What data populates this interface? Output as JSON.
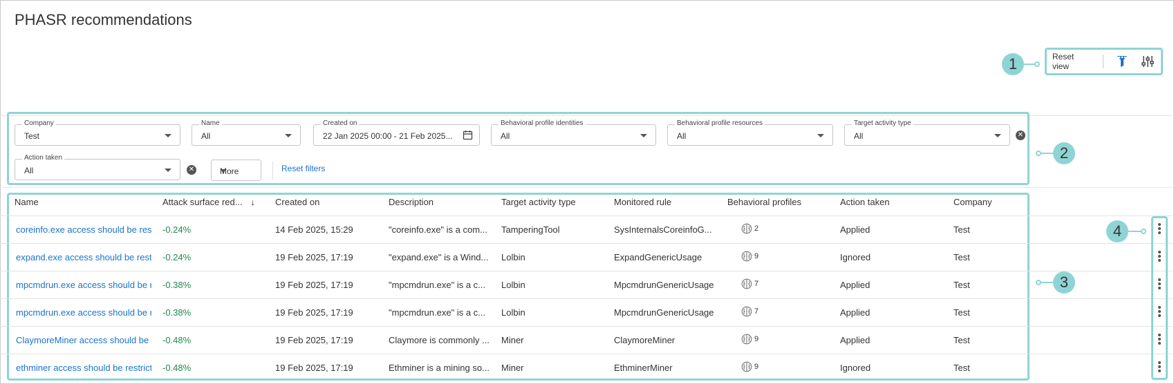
{
  "page": {
    "title": "PHASR recommendations"
  },
  "toolbar": {
    "reset_view": "Reset view",
    "icons": [
      "filter-icon",
      "column-settings-icon"
    ]
  },
  "filters": {
    "company": {
      "label": "Company",
      "value": "Test"
    },
    "name": {
      "label": "Name",
      "value": "All"
    },
    "created_on": {
      "label": "Created on",
      "value": "22 Jan 2025 00:00 - 21 Feb 2025..."
    },
    "bp_identities": {
      "label": "Behavioral profile identities",
      "value": "All"
    },
    "bp_resources": {
      "label": "Behavioral profile resources",
      "value": "All"
    },
    "target_activity": {
      "label": "Target activity type",
      "value": "All"
    },
    "action_taken": {
      "label": "Action taken",
      "value": "All"
    },
    "more": "More",
    "reset": "Reset filters"
  },
  "table": {
    "columns": [
      "Name",
      "Attack surface red...",
      "Created on",
      "Description",
      "Target activity type",
      "Monitored rule",
      "Behavioral profiles",
      "Action taken",
      "Company"
    ],
    "sort_indicator": "↓",
    "rows": [
      {
        "name": "coreinfo.exe access should be restricted",
        "attack": "-0.24%",
        "created": "14 Feb 2025, 15:29",
        "description": "\"coreinfo.exe\" is a com...",
        "target": "TamperingTool",
        "rule": "SysInternalsCoreinfoG...",
        "profiles": "2",
        "action": "Applied",
        "company": "Test"
      },
      {
        "name": "expand.exe access should be restricted",
        "attack": "-0.24%",
        "created": "19 Feb 2025, 17:19",
        "description": "\"expand.exe\" is a Wind...",
        "target": "Lolbin",
        "rule": "ExpandGenericUsage",
        "profiles": "9",
        "action": "Ignored",
        "company": "Test"
      },
      {
        "name": "mpcmdrun.exe access should be restricted",
        "attack": "-0.38%",
        "created": "19 Feb 2025, 17:19",
        "description": "\"mpcmdrun.exe\" is a c...",
        "target": "Lolbin",
        "rule": "MpcmdrunGenericUsage",
        "profiles": "7",
        "action": "Applied",
        "company": "Test"
      },
      {
        "name": "mpcmdrun.exe access should be restricted",
        "attack": "-0.38%",
        "created": "19 Feb 2025, 17:19",
        "description": "\"mpcmdrun.exe\" is a c...",
        "target": "Lolbin",
        "rule": "MpcmdrunGenericUsage",
        "profiles": "7",
        "action": "Applied",
        "company": "Test"
      },
      {
        "name": "ClaymoreMiner access should be restricted",
        "attack": "-0.48%",
        "created": "19 Feb 2025, 17:19",
        "description": "Claymore is commonly ...",
        "target": "Miner",
        "rule": "ClaymoreMiner",
        "profiles": "9",
        "action": "Applied",
        "company": "Test"
      },
      {
        "name": "ethminer access should be restricted",
        "attack": "-0.48%",
        "created": "19 Feb 2025, 17:19",
        "description": "Ethminer is a mining so...",
        "target": "Miner",
        "rule": "EthminerMiner",
        "profiles": "9",
        "action": "Ignored",
        "company": "Test"
      }
    ]
  },
  "callouts": [
    "1",
    "2",
    "3",
    "4"
  ],
  "colors": {
    "accent": "#8fd4d4",
    "link": "#1a73c8",
    "negative_pct": "#1e8a4c",
    "filter_icon": "#1a73c8"
  }
}
